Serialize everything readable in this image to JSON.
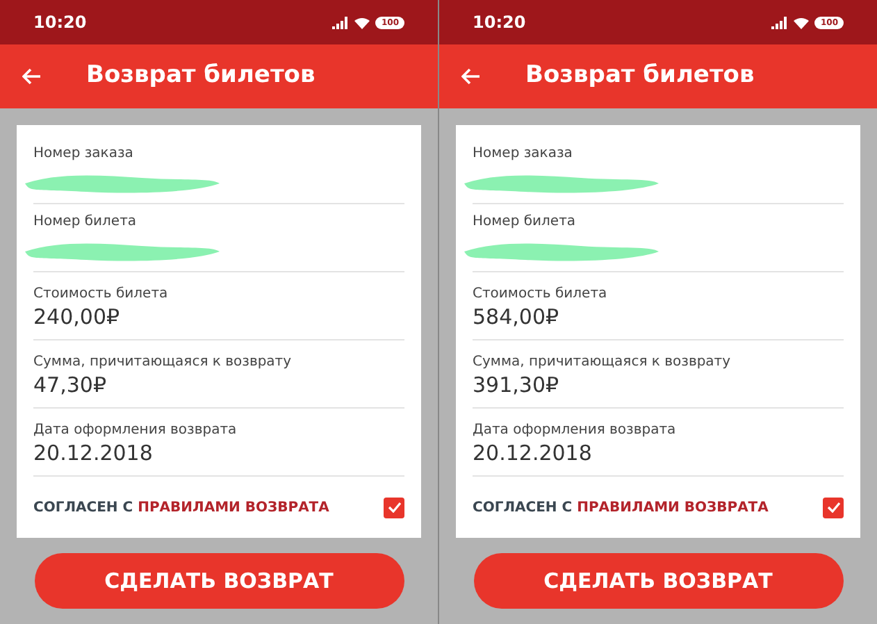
{
  "screens": [
    {
      "status_bar": {
        "time": "10:20",
        "battery": "100"
      },
      "app_bar": {
        "title": "Возврат билетов"
      },
      "fields": [
        {
          "label": "Номер заказа",
          "redacted": true
        },
        {
          "label": "Номер билета",
          "redacted": true
        },
        {
          "label": "Стоимость билета",
          "value": "240,00₽",
          "redacted": false
        },
        {
          "label": "Сумма, причитающаяся к возврату",
          "value": "47,30₽",
          "redacted": false
        },
        {
          "label": "Дата оформления возврата",
          "value": "20.12.2018",
          "redacted": false
        }
      ],
      "agreement": {
        "text": "СОГЛАСЕН С",
        "link": "ПРАВИЛАМИ ВОЗВРАТА",
        "checked": true
      },
      "button": "СДЕЛАТЬ ВОЗВРАТ"
    },
    {
      "status_bar": {
        "time": "10:20",
        "battery": "100"
      },
      "app_bar": {
        "title": "Возврат билетов"
      },
      "fields": [
        {
          "label": "Номер заказа",
          "redacted": true
        },
        {
          "label": "Номер билета",
          "redacted": true
        },
        {
          "label": "Стоимость билета",
          "value": "584,00₽",
          "redacted": false
        },
        {
          "label": "Сумма, причитающаяся к возврату",
          "value": "391,30₽",
          "redacted": false
        },
        {
          "label": "Дата оформления возврата",
          "value": "20.12.2018",
          "redacted": false
        }
      ],
      "agreement": {
        "text": "СОГЛАСЕН С",
        "link": "ПРАВИЛАМИ ВОЗВРАТА",
        "checked": true
      },
      "button": "СДЕЛАТЬ ВОЗВРАТ"
    }
  ]
}
